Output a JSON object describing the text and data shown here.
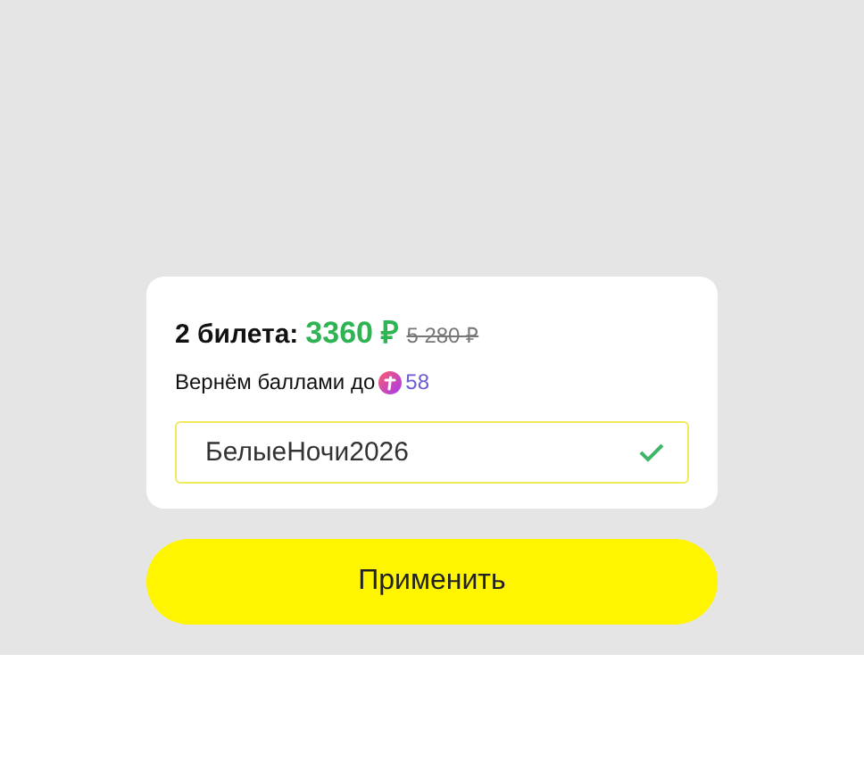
{
  "summary": {
    "tickets": "2 билета:",
    "price": "3360 ₽",
    "old_price": "5 280 ₽"
  },
  "cashback": {
    "text": "Вернём баллами до",
    "points": "58"
  },
  "promo": {
    "value": "БелыеНочи2026",
    "valid": true
  },
  "apply_button": "Применить"
}
